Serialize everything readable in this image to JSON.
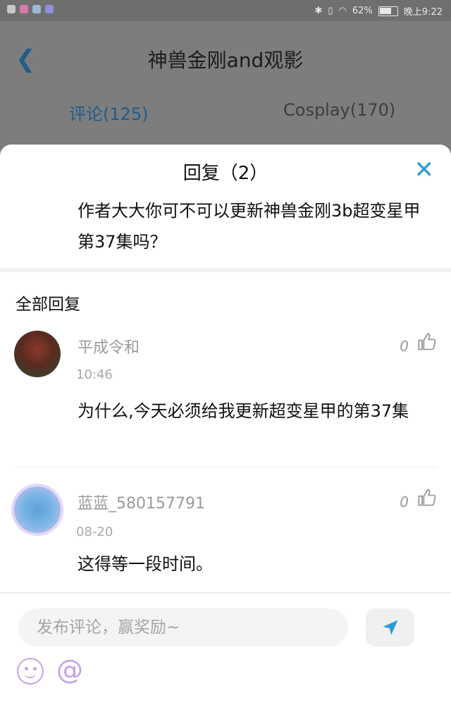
{
  "status_bar": {
    "battery": "62%",
    "time": "晚上9:22"
  },
  "header": {
    "title": "神兽金刚and观影",
    "tabs": [
      "评论(125)",
      "Cosplay(170)"
    ]
  },
  "reply_sheet": {
    "title": "回复（2）",
    "question": "作者大大你可不可以更新神兽金刚3b超变星甲第37集吗？",
    "section_title": "全部回复",
    "replies": [
      {
        "name": "平成令和",
        "time": "10:46",
        "likes": "0",
        "text": "为什么,今天必须给我更新超变星甲的第37集"
      },
      {
        "name": "蓝蓝_580157791",
        "time": "08-20",
        "likes": "0",
        "text": "这得等一段时间。"
      }
    ]
  },
  "composer": {
    "placeholder": "发布评论，赢奖励~"
  },
  "icons": [
    "back-icon",
    "close-icon",
    "thumbs-up-icon",
    "send-icon",
    "emoji-icon",
    "at-icon"
  ],
  "colors": {
    "accent": "#2d9ad8",
    "tab_active": "#1e5d8a",
    "emoji": "#c6a2e4"
  }
}
